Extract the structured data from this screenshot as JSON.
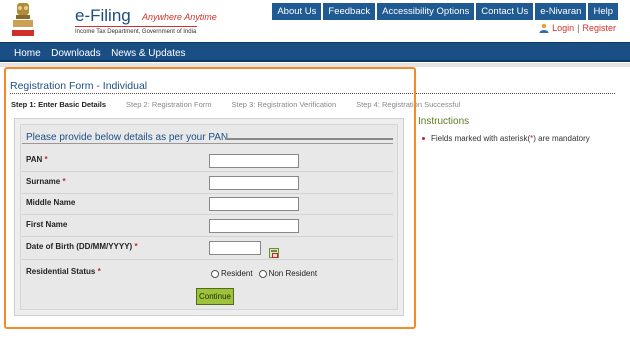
{
  "header": {
    "brand": "e-Filing",
    "tagline": "Anywhere Anytime",
    "subtitle": "Income Tax Department, Government of India"
  },
  "topnav": [
    {
      "label": "About Us"
    },
    {
      "label": "Feedback"
    },
    {
      "label": "Accessibility Options"
    },
    {
      "label": "Contact Us"
    },
    {
      "label": "e-Nivaran"
    },
    {
      "label": "Help"
    }
  ],
  "auth": {
    "login": "Login",
    "separator": "|",
    "register": "Register"
  },
  "mainnav": [
    {
      "label": "Home"
    },
    {
      "label": "Downloads"
    },
    {
      "label": "News & Updates"
    }
  ],
  "form": {
    "title": "Registration Form - Individual",
    "steps": [
      "Step 1: Enter Basic Details",
      "Step 2: Registration Form",
      "Step 3: Registration Verification",
      "Step 4: Registration Successful"
    ],
    "panel_title": "Please provide below details as per your PAN",
    "fields": {
      "pan": {
        "label": "PAN",
        "value": ""
      },
      "surname": {
        "label": "Surname",
        "value": ""
      },
      "middle_name": {
        "label": "Middle Name",
        "value": ""
      },
      "first_name": {
        "label": "First Name",
        "value": ""
      },
      "dob": {
        "label": "Date of Birth (DD/MM/YYYY)",
        "value": ""
      },
      "residential_status": {
        "label": "Residential Status",
        "options": [
          "Resident",
          "Non Resident"
        ]
      }
    },
    "required_marker": "*",
    "continue_label": "Continue"
  },
  "instructions": {
    "title": "Instructions",
    "item_prefix": "Fields marked with asterisk(",
    "item_marker": "*",
    "item_suffix": ") are mandatory"
  },
  "colors": {
    "nav_blue": "#1f5a92",
    "mainnav_blue": "#1a4f86",
    "highlight_orange": "#f28b28",
    "button_green": "#9cc33a",
    "required_red": "#c0272d"
  }
}
